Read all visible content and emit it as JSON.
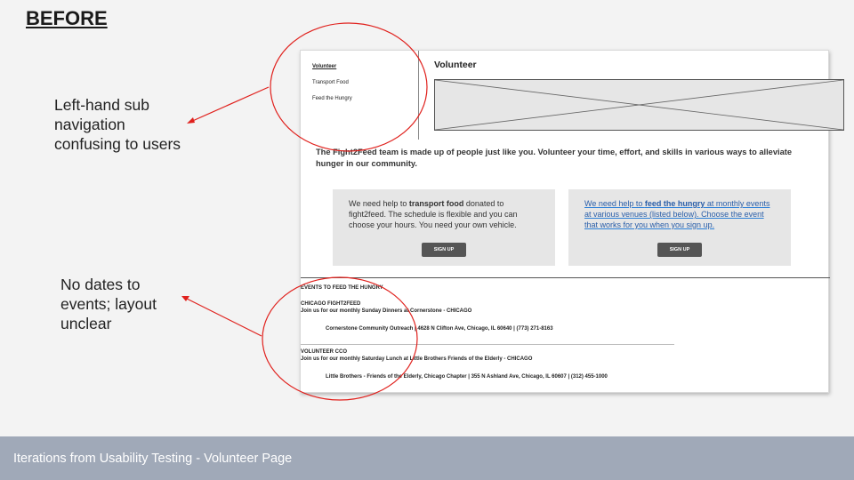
{
  "slide": {
    "title": "BEFORE",
    "notes": [
      "Left-hand sub navigation confusing to users",
      "No dates to events; layout unclear"
    ],
    "footer": "Iterations from Usability Testing - Volunteer Page"
  },
  "mockup": {
    "subnav": [
      "Volunteer",
      "Transport Food",
      "Feed the Hungry"
    ],
    "heading": "Volunteer",
    "intro": "The Fight2Feed team is made up of people just like you. Volunteer your time, effort, and skills in various ways to alleviate hunger in our community.",
    "cards": [
      {
        "text_pre": "We need help to ",
        "text_bold": "transport food",
        "text_post": " donated to fight2feed. The schedule is flexible and you can choose your hours. You need your own vehicle.",
        "button": "SIGN UP"
      },
      {
        "text_pre": "We need help to ",
        "text_bold": "feed the hungry",
        "text_post": " at monthly events at various venues (listed below). Choose the event that works for you when you sign up.",
        "button": "SIGN UP"
      }
    ],
    "events_title": "EVENTS TO FEED THE HUNGRY",
    "events": [
      {
        "name": "CHICAGO FIGHT2FEED",
        "desc": "Join us for our monthly Sunday Dinners at Cornerstone - CHICAGO",
        "address": "Cornerstone Community Outreach | 4628 N Clifton Ave, Chicago, IL 60640 | (773) 271-8163"
      },
      {
        "name": "VOLUNTEER CCO",
        "desc": "Join us for our monthly Saturday Lunch at Little Brothers Friends of the Elderly - CHICAGO",
        "address": "Little Brothers - Friends of the Elderly, Chicago Chapter | 355 N Ashland Ave, Chicago, IL 60607 | (312) 455-1000"
      }
    ]
  },
  "colors": {
    "annotation": "#e0201c",
    "footer_bg": "#a0a9b8",
    "card_bg": "#e6e6e6",
    "button_bg": "#555555",
    "link": "#2a7fd8"
  }
}
